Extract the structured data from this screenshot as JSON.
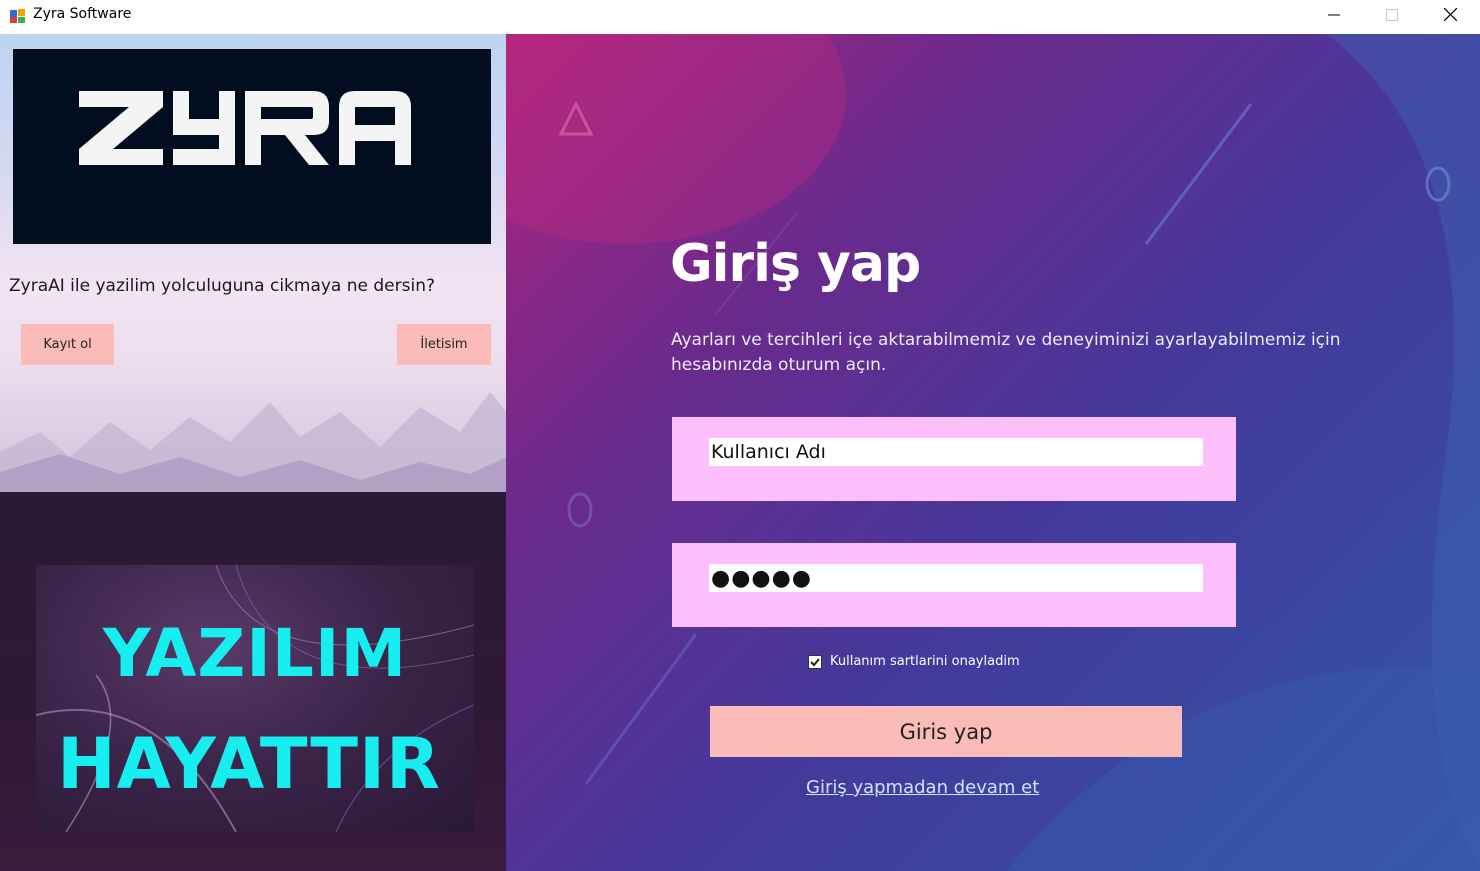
{
  "window": {
    "title": "Zyra Software",
    "icons": {
      "app": "windows-form-icon",
      "minimize": "minimize-icon",
      "maximize": "maximize-icon",
      "close": "close-icon"
    }
  },
  "left_panel": {
    "logo_text": "ZYRA",
    "tagline": "ZyraAI ile yazilim yolculuguna cikmaya ne dersin?",
    "signup_label": "Kayıt ol",
    "contact_label": "İletisim",
    "banner": {
      "line1": "YAZILIM",
      "line2": "HAYATTIR"
    }
  },
  "login": {
    "title": "Giriş yap",
    "description": "Ayarları ve tercihleri içe aktarabilmemiz ve deneyiminizi ayarlayabilmemiz için hesabınızda oturum açın.",
    "username_value": "Kullanıcı Adı",
    "password_masked": "●●●●●",
    "terms_label": "Kullanım sartlarini onayladim",
    "terms_checked": true,
    "submit_label": "Giris yap",
    "guest_link": "Giriş yapmadan devam et"
  },
  "colors": {
    "button_pink": "#fbbcb9",
    "field_pink": "#fdbffc",
    "banner_cyan": "#17eef0",
    "logo_bg": "#020e1f"
  }
}
